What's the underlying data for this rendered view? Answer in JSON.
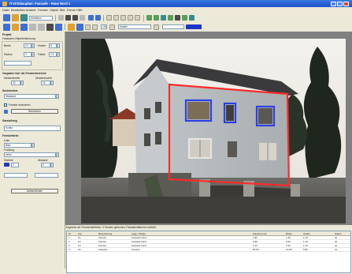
{
  "window": {
    "title": "IT-Ortsbauplan: Fassade - Haus Nord 1",
    "controls": [
      "minimize",
      "maximize",
      "close"
    ]
  },
  "menu": [
    "Datei",
    "Bearbeiten",
    "Ansicht",
    "Fenster",
    "Objekt",
    "Bild",
    "Extras",
    "Hilfe"
  ],
  "toolbar": {
    "mode_label": "Detektion",
    "zoom_value": "100%",
    "filter_value": "Kanten"
  },
  "panel": {
    "section1_title": "Projekt",
    "section1_sub": "Fassaden-Objekterkennung",
    "fields1": [
      {
        "label": "Breite",
        "value": "12"
      },
      {
        "label": "Hoehe",
        "value": "8"
      },
      {
        "label": "Radius",
        "value": "3"
      },
      {
        "label": "Faktor",
        "value": "1.0"
      }
    ],
    "section2_title": "Vorgaben fuer die Fensterbereiche",
    "section2_cols": [
      "Mindestbreite",
      "Mindesthoehe"
    ],
    "section2_values": [
      "20",
      "15"
    ],
    "section3_title": "Suchmodus",
    "section3_select": "Standard",
    "check1": "Fenster markieren",
    "button1": "Berechnen",
    "section4_title": "Darstellung",
    "section4_input": "Kontur",
    "section5_title": "Fensterfarbe",
    "section5_rows": [
      {
        "label": "Linie",
        "value": "Blau"
      },
      {
        "label": "Fuellung",
        "value": "keine"
      },
      {
        "label": "Staerke",
        "value": "2"
      },
      {
        "label": "Abstand",
        "value": "5"
      }
    ],
    "button2": "Uebernehmen"
  },
  "results": {
    "caption": "Ergebnis der Fensterdetektion: 3 Fenster gefunden, Fassadenflaeche markiert",
    "headers": [
      "Nr",
      "Typ",
      "Bezeichnung",
      "Lage / Objekt",
      "Flaeche [m2]",
      "Breite",
      "Hoehe",
      "Status"
    ],
    "rows": [
      [
        "1",
        "F1",
        "Fenster",
        "Fassade Nord",
        "1.82",
        "1.20",
        "1.10",
        "ok"
      ],
      [
        "2",
        "F2",
        "Fenster",
        "Fassade Nord",
        "0.96",
        "0.60",
        "1.10",
        "ok"
      ],
      [
        "3",
        "F3",
        "Fenster",
        "Fassade Nord",
        "1.44",
        "1.00",
        "1.10",
        "ok"
      ],
      [
        "4",
        "FA",
        "Fassade",
        "Gesamt",
        "84.50",
        "13.00",
        "6.50",
        "ok"
      ]
    ]
  },
  "colors": {
    "facade_outline": "#ff2a2a",
    "window_outline": "#2d3fe6",
    "title_bar": "#2a66d8"
  }
}
